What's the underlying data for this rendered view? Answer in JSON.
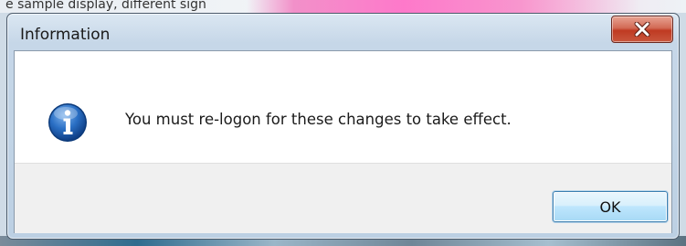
{
  "background": {
    "top_text": "e sample display, different sign"
  },
  "dialog": {
    "title": "Information",
    "message": "You must re-logon for these changes to take effect.",
    "icon": "info-icon",
    "ok_label": "OK",
    "close_icon": "close-icon"
  },
  "colors": {
    "close_button": "#c9452c",
    "ok_button_border": "#3c7fb1",
    "info_icon_blue": "#1e62b6"
  }
}
